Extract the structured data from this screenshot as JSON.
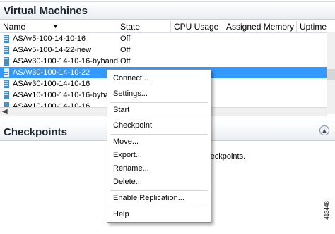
{
  "vm_section": {
    "title": "Virtual Machines"
  },
  "columns": [
    "Name",
    "State",
    "CPU Usage",
    "Assigned Memory",
    "Uptime"
  ],
  "rows": [
    {
      "name": "ASAv5-100-14-10-16",
      "state": "Off"
    },
    {
      "name": "ASAv5-100-14-22-new",
      "state": "Off"
    },
    {
      "name": "ASAv30-100-14-10-16-byhand",
      "state": "Off"
    },
    {
      "name": "ASAv30-100-14-10-22",
      "state": ""
    },
    {
      "name": "ASAv30-100-14-10-16",
      "state": ""
    },
    {
      "name": "ASAv10-100-14-10-16-byha",
      "state": ""
    },
    {
      "name": "ASAv10-100-14-10-16",
      "state": ""
    }
  ],
  "checkpoints_section": {
    "title": "Checkpoints",
    "body_text": "checkpoints."
  },
  "context_menu": {
    "connect": "Connect...",
    "settings": "Settings...",
    "start": "Start",
    "checkpoint": "Checkpoint",
    "move": "Move...",
    "export": "Export...",
    "rename": "Rename...",
    "delete": "Delete...",
    "enable_replication": "Enable Replication...",
    "help": "Help"
  },
  "figure_number": "413448"
}
